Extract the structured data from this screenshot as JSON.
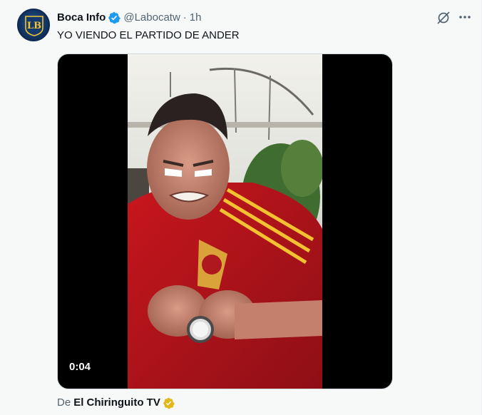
{
  "tweet": {
    "author_name": "Boca Info",
    "author_handle": "@Labocatw",
    "separator": "·",
    "time_ago": "1h",
    "text": "YO VIENDO EL PARTIDO DE ANDER",
    "avatar_logo_text": "LB",
    "verified_color": "#1d9bf0"
  },
  "media": {
    "type": "video",
    "timestamp": "0:04"
  },
  "attribution": {
    "prefix": "De",
    "source": "El Chiringuito TV",
    "badge_color": "#e2b719"
  },
  "icons": {
    "verified": "verified-badge-icon",
    "grok": "grok-icon",
    "more": "more-options-icon",
    "attribution_badge": "gold-verified-badge-icon"
  }
}
